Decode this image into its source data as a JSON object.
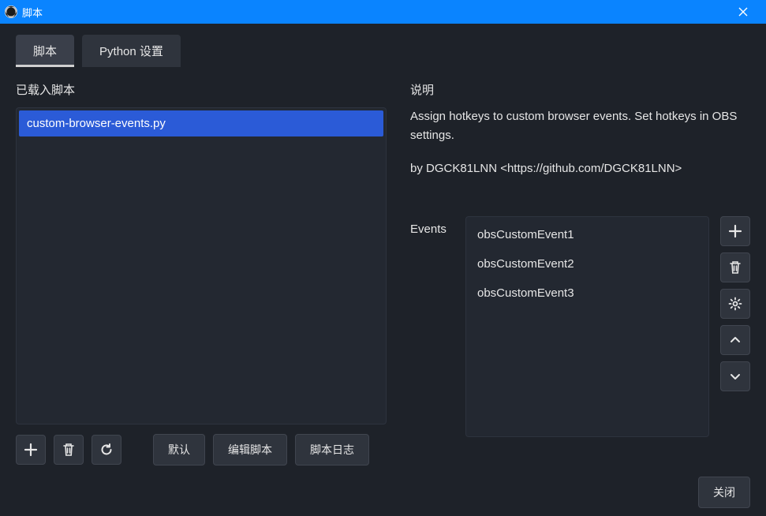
{
  "window": {
    "title": "脚本"
  },
  "tabs": {
    "scripts": "脚本",
    "python": "Python 设置"
  },
  "left": {
    "heading": "已载入脚本",
    "scripts": [
      {
        "name": "custom-browser-events.py",
        "selected": true
      }
    ],
    "buttons": {
      "defaults": "默认",
      "edit": "编辑脚本",
      "log": "脚本日志"
    }
  },
  "right": {
    "heading": "说明",
    "desc1": "Assign hotkeys to custom browser events. Set hotkeys in OBS settings.",
    "desc2": "by DGCK81LNN <https://github.com/DGCK81LNN>",
    "events_label": "Events",
    "events": [
      "obsCustomEvent1",
      "obsCustomEvent2",
      "obsCustomEvent3"
    ]
  },
  "footer": {
    "close": "关闭"
  }
}
